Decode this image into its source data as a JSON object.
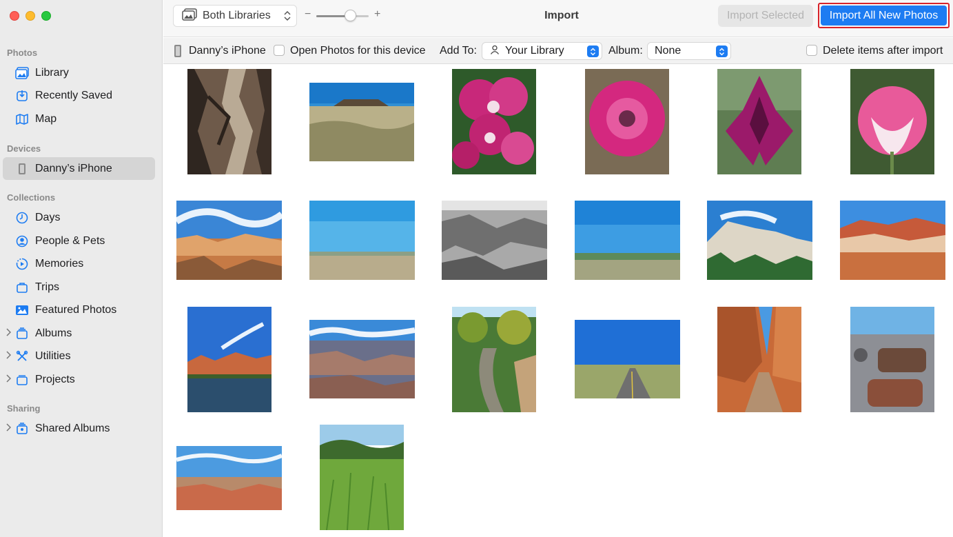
{
  "sidebar": {
    "sections": {
      "photos": "Photos",
      "devices": "Devices",
      "collections": "Collections",
      "sharing": "Sharing"
    },
    "items": [
      {
        "label": "Library",
        "icon": "library-icon"
      },
      {
        "label": "Recently Saved",
        "icon": "recently-saved-icon"
      },
      {
        "label": "Map",
        "icon": "map-icon"
      },
      {
        "label": "Danny’s iPhone",
        "icon": "iphone-icon",
        "selected": true
      },
      {
        "label": "Days",
        "icon": "clock-icon"
      },
      {
        "label": "People & Pets",
        "icon": "person-icon"
      },
      {
        "label": "Memories",
        "icon": "memories-icon"
      },
      {
        "label": "Trips",
        "icon": "suitcase-icon"
      },
      {
        "label": "Featured Photos",
        "icon": "featured-photo-icon"
      },
      {
        "label": "Albums",
        "icon": "albums-icon"
      },
      {
        "label": "Utilities",
        "icon": "utilities-icon"
      },
      {
        "label": "Projects",
        "icon": "projects-icon"
      },
      {
        "label": "Shared Albums",
        "icon": "shared-albums-icon"
      }
    ]
  },
  "toolbar": {
    "library_selector": "Both Libraries",
    "zoom_minus": "−",
    "zoom_plus": "+",
    "zoom_level": 0.65,
    "title": "Import",
    "import_selected": "Import Selected",
    "import_all": "Import All New Photos"
  },
  "device_bar": {
    "device_name": "Danny’s iPhone",
    "open_photos_label": "Open Photos for this device",
    "open_photos_checked": false,
    "add_to_label": "Add To:",
    "add_to_value": "Your Library",
    "album_label": "Album:",
    "album_value": "None",
    "delete_label": "Delete items after import",
    "delete_checked": false
  },
  "colors": {
    "accent": "#1d7cf2",
    "highlight_border": "#d7222a",
    "sidebar_bg": "#ebebeb"
  },
  "photos": [
    {
      "subject": "tree bark"
    },
    {
      "subject": "grassland mesa"
    },
    {
      "subject": "pink orchids"
    },
    {
      "subject": "pink tulip"
    },
    {
      "subject": "magenta tulip"
    },
    {
      "subject": "pink white tulip"
    },
    {
      "subject": "canyon hoodoos"
    },
    {
      "subject": "open plain"
    },
    {
      "subject": "badlands black and white"
    },
    {
      "subject": "green horizon"
    },
    {
      "subject": "white cliffs"
    },
    {
      "subject": "red rock ridge"
    },
    {
      "subject": "river mesa reflection"
    },
    {
      "subject": "grand canyon"
    },
    {
      "subject": "creek valley"
    },
    {
      "subject": "desert highway"
    },
    {
      "subject": "slot canyon road"
    },
    {
      "subject": "petrified wood"
    },
    {
      "subject": "painted desert"
    },
    {
      "subject": "green meadow"
    }
  ]
}
